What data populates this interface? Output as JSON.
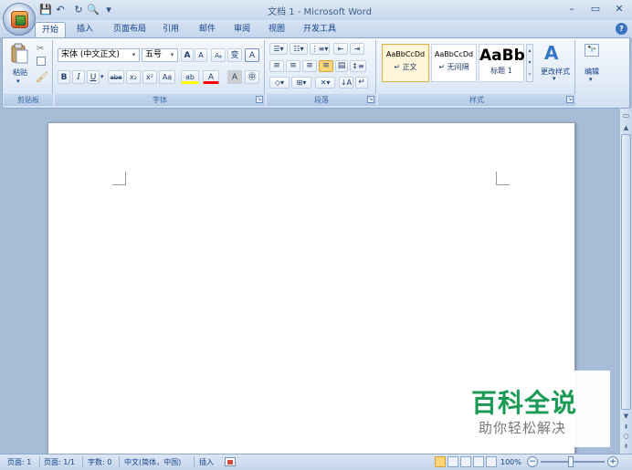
{
  "window": {
    "title": "文档 1 - Microsoft Word",
    "minimize": "–",
    "maximize": "▭",
    "close": "✕"
  },
  "qat": {
    "save": "💾",
    "undo": "↶",
    "redo": "↻",
    "print_preview": "🔍",
    "customize": "▾"
  },
  "tabs": [
    {
      "label": "开始",
      "active": true
    },
    {
      "label": "插入"
    },
    {
      "label": "页面布局"
    },
    {
      "label": "引用"
    },
    {
      "label": "邮件"
    },
    {
      "label": "审阅"
    },
    {
      "label": "视图"
    },
    {
      "label": "开发工具"
    }
  ],
  "help": "?",
  "clipboard": {
    "paste_label": "粘贴",
    "group_label": "剪贴板"
  },
  "font": {
    "font_name": "宋体 (中文正文)",
    "font_size": "五号",
    "grow": "A",
    "shrink": "A",
    "clear": "Aᵩ",
    "phonetic": "变",
    "border_char": "A",
    "bold": "B",
    "italic": "I",
    "underline": "U",
    "strike": "abe",
    "subscript": "x₂",
    "superscript": "x²",
    "change_case": "Aa",
    "highlight": "ab",
    "font_color": "A",
    "shading": "A",
    "enclose": "㊥",
    "group_label": "字体"
  },
  "paragraph": {
    "group_label": "段落"
  },
  "styles": {
    "items": [
      {
        "sample": "AaBbCcDd",
        "name": "正文",
        "selected": true
      },
      {
        "sample": "AaBbCcDd",
        "name": "无间隔"
      },
      {
        "sample": "AaBb",
        "name": "标题 1"
      }
    ],
    "change_styles": "更改样式",
    "group_label": "样式"
  },
  "editing": {
    "label": "编辑"
  },
  "status": {
    "page": "页面: 1",
    "pages": "页面: 1/1",
    "words": "字数: 0",
    "language": "中文(简体，中国)",
    "mode": "插入",
    "zoom": "100%"
  },
  "watermark": {
    "title": "百科全说",
    "subtitle": "助你轻松解决"
  },
  "colors": {
    "highlight": "#ffff00",
    "font_color": "#ff0000",
    "brand_green": "#1b9a54"
  }
}
